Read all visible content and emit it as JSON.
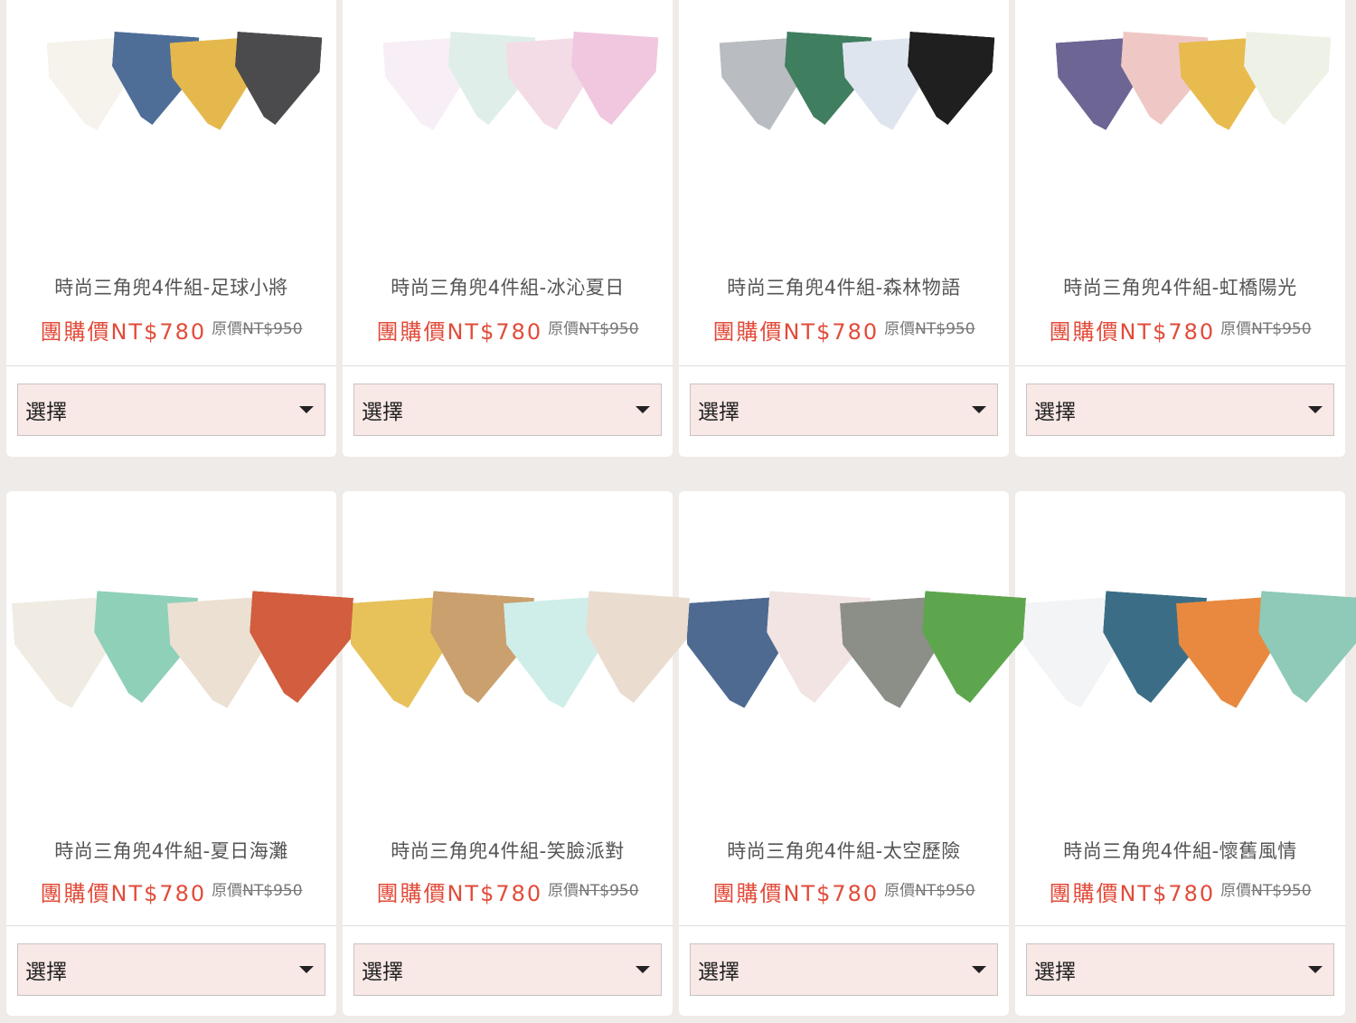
{
  "products": [
    {
      "title": "時尚三角兜4件組-足球小將",
      "group_price": "團購價NT$780",
      "orig_label": "原價",
      "orig_price": "NT$950",
      "select": "選擇",
      "colors": [
        "#f6f2ec",
        "#4e6e98",
        "#e5b84d",
        "#4b4b4d"
      ]
    },
    {
      "title": "時尚三角兜4件組-冰沁夏日",
      "group_price": "團購價NT$780",
      "orig_label": "原價",
      "orig_price": "NT$950",
      "select": "選擇",
      "colors": [
        "#f7eef6",
        "#dfeee9",
        "#f3dce6",
        "#f0c7df"
      ]
    },
    {
      "title": "時尚三角兜4件組-森林物語",
      "group_price": "團購價NT$780",
      "orig_label": "原價",
      "orig_price": "NT$950",
      "select": "選擇",
      "colors": [
        "#b9bcc1",
        "#3f7e5f",
        "#dfe5ee",
        "#1f1f20"
      ]
    },
    {
      "title": "時尚三角兜4件組-虹橋陽光",
      "group_price": "團購價NT$780",
      "orig_label": "原價",
      "orig_price": "NT$950",
      "select": "選擇",
      "colors": [
        "#6d6694",
        "#efc8c6",
        "#e8bb4e",
        "#eef1e6"
      ]
    },
    {
      "title": "時尚三角兜4件組-夏日海灘",
      "group_price": "團購價NT$780",
      "orig_label": "原價",
      "orig_price": "NT$950",
      "select": "選擇",
      "colors": [
        "#f0ece4",
        "#8fd0b9",
        "#ece0d2",
        "#d25d3f"
      ]
    },
    {
      "title": "時尚三角兜4件組-笑臉派對",
      "group_price": "團購價NT$780",
      "orig_label": "原價",
      "orig_price": "NT$950",
      "select": "選擇",
      "colors": [
        "#e7c25a",
        "#caa06e",
        "#cfeee9",
        "#eaddd0"
      ]
    },
    {
      "title": "時尚三角兜4件組-太空歷險",
      "group_price": "團購價NT$780",
      "orig_label": "原價",
      "orig_price": "NT$950",
      "select": "選擇",
      "colors": [
        "#4e6a90",
        "#f1e4e2",
        "#8c8f88",
        "#5ea64e"
      ]
    },
    {
      "title": "時尚三角兜4件組-懷舊風情",
      "group_price": "團購價NT$780",
      "orig_label": "原價",
      "orig_price": "NT$950",
      "select": "選擇",
      "colors": [
        "#f3f4f6",
        "#3b6e86",
        "#e8893f",
        "#8fc9b8"
      ]
    }
  ]
}
